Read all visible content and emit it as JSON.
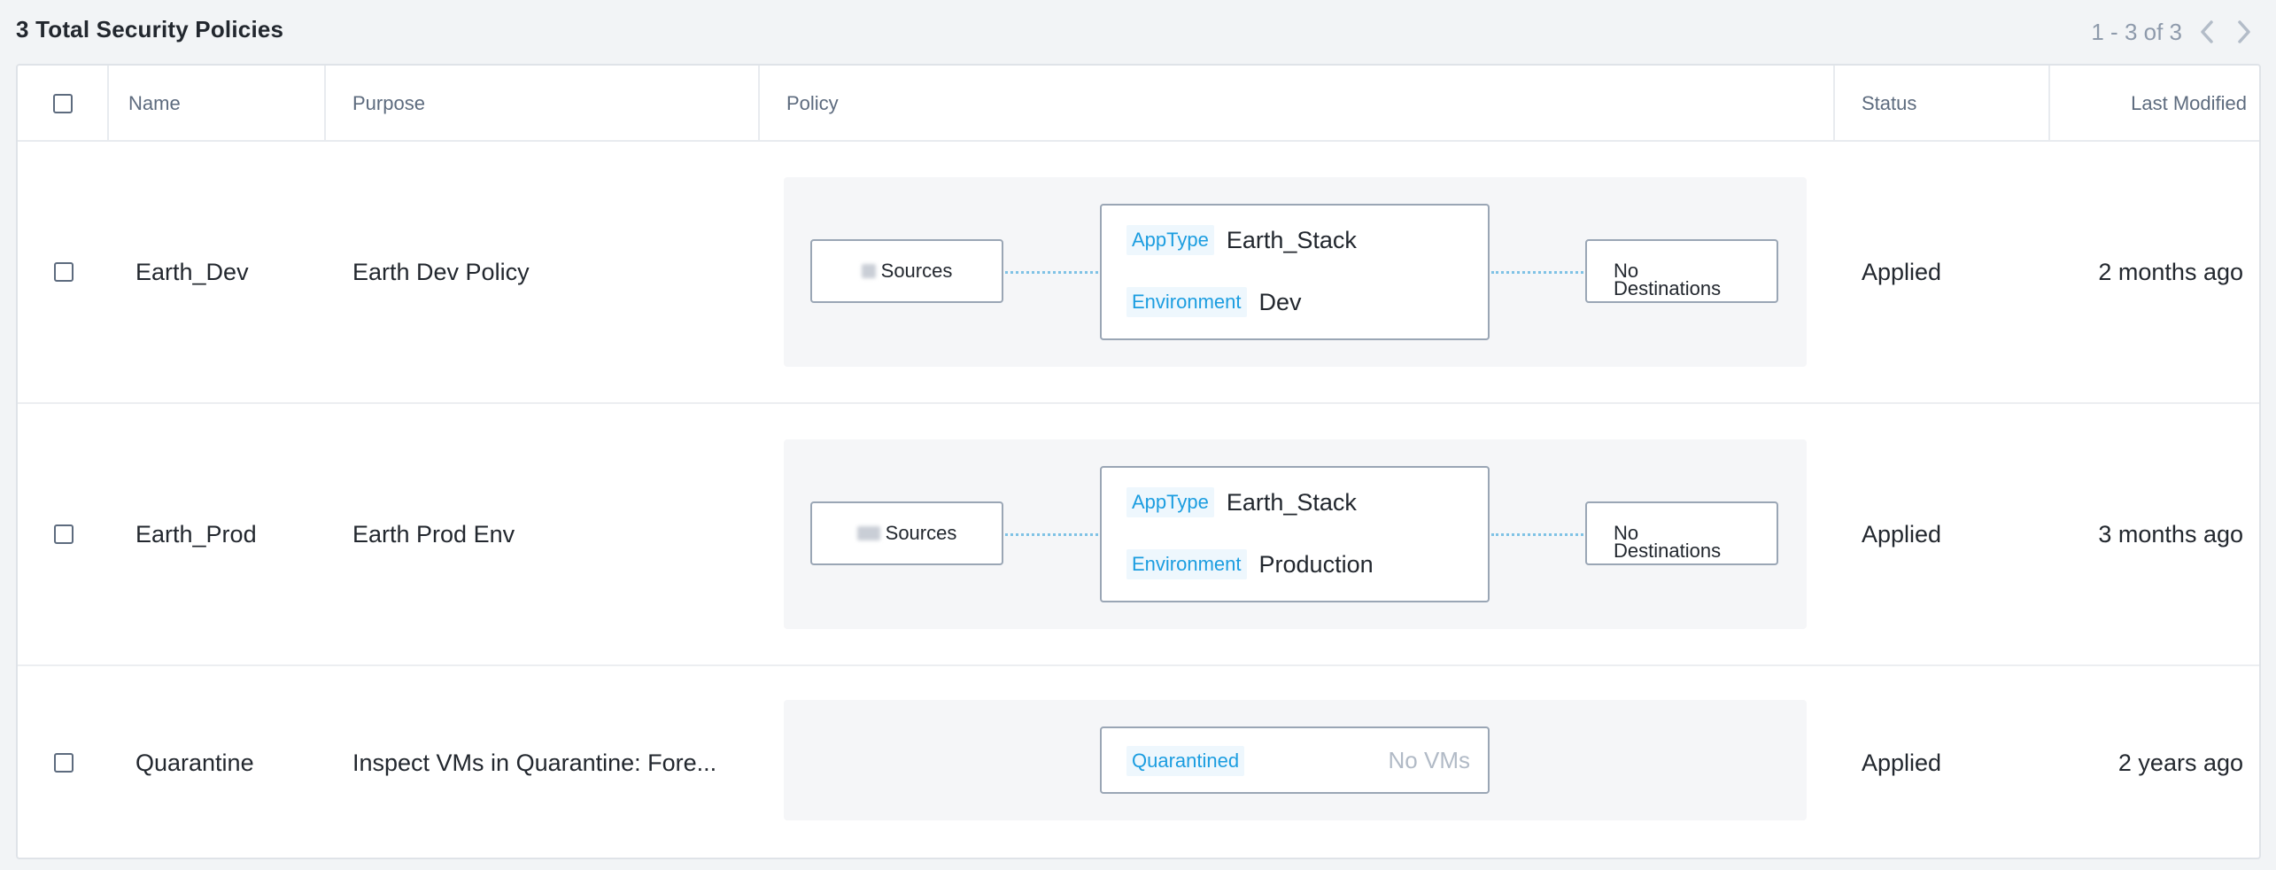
{
  "header": {
    "total_title": "3 Total Security Policies",
    "pager_text": "1 - 3 of 3",
    "prev_icon": "chevron-left-icon",
    "next_icon": "chevron-right-icon"
  },
  "columns": {
    "name": "Name",
    "purpose": "Purpose",
    "policy": "Policy",
    "status": "Status",
    "last_modified": "Last Modified"
  },
  "rows": [
    {
      "name": "Earth_Dev",
      "purpose": "Earth Dev Policy",
      "sources_label": "Sources",
      "dest_label_1": "No",
      "dest_label_2": "Destinations",
      "category_1_key": "AppType",
      "category_1_value": "Earth_Stack",
      "category_2_key": "Environment",
      "category_2_value": "Dev",
      "status": "Applied",
      "last_modified": "2 months ago"
    },
    {
      "name": "Earth_Prod",
      "purpose": "Earth Prod Env",
      "sources_label": "Sources",
      "dest_label_1": "No",
      "dest_label_2": "Destinations",
      "category_1_key": "AppType",
      "category_1_value": "Earth_Stack",
      "category_2_key": "Environment",
      "category_2_value": "Production",
      "status": "Applied",
      "last_modified": "3 months ago"
    },
    {
      "name": "Quarantine",
      "purpose": "Inspect VMs in Quarantine: Fore...",
      "quarantine_key": "Quarantined",
      "quarantine_value": "No VMs",
      "status": "Applied",
      "last_modified": "2 years ago"
    }
  ],
  "colors": {
    "accent": "#1b9de0",
    "border": "#9aa6b5",
    "muted_text": "#8e9aab"
  }
}
